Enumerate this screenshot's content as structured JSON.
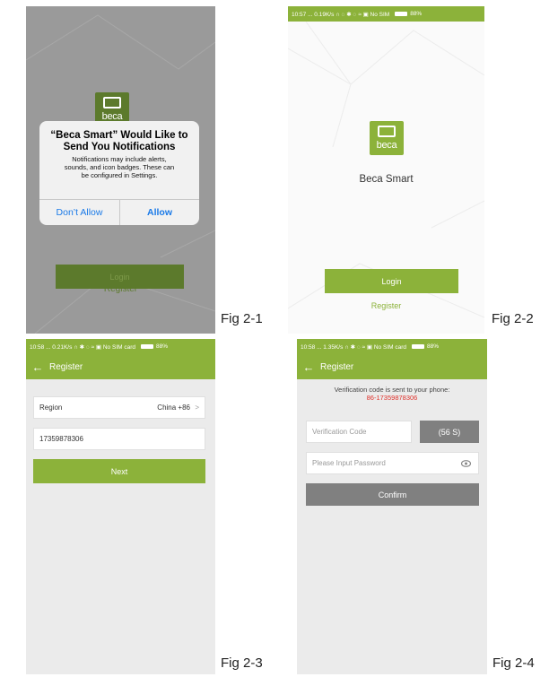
{
  "figures": {
    "f1": {
      "label": "Fig 2-1",
      "logo_text": "beca",
      "dialog": {
        "title_line1": "“Beca Smart” Would Like to",
        "title_line2": "Send You Notifications",
        "body_line1": "Notifications may include alerts,",
        "body_line2": "sounds, and icon badges. These can",
        "body_line3": "be configured in Settings.",
        "dont_allow": "Don’t Allow",
        "allow": "Allow"
      },
      "login": "Login",
      "register": "Register"
    },
    "f2": {
      "label": "Fig 2-2",
      "status": "10:57 ... 0.19K/s ∩ ◌ ✱ ◌ ≈ ▣ No SIM",
      "battery": "88%",
      "logo_text": "beca",
      "app_name": "Beca Smart",
      "login": "Login",
      "register": "Register"
    },
    "f3": {
      "label": "Fig 2-3",
      "status": "10:58 ... 0.21K/s ∩ ✱ ◌ ≈ ▣ No SIM card",
      "battery": "88%",
      "back": "←",
      "title": "Register",
      "region_label": "Region",
      "region_value": "China +86",
      "chevron": ">",
      "phone": "17359878306",
      "next": "Next"
    },
    "f4": {
      "label": "Fig 2-4",
      "status": "10:58 ... 1.35K/s ∩ ✱ ◌ ≈ ▣ No SIM card",
      "battery": "88%",
      "back": "←",
      "title": "Register",
      "sent_text": "Verification code is sent to your phone:",
      "sent_phone": "86-17359878306",
      "code_placeholder": "Verification Code",
      "countdown": "(56 S)",
      "password_placeholder": "Please Input Password",
      "confirm": "Confirm"
    }
  },
  "colors": {
    "green": "#8cb23a",
    "gray_bg": "#ebebeb",
    "red_text": "#e0312b",
    "ios_blue": "#1a7ae8"
  }
}
